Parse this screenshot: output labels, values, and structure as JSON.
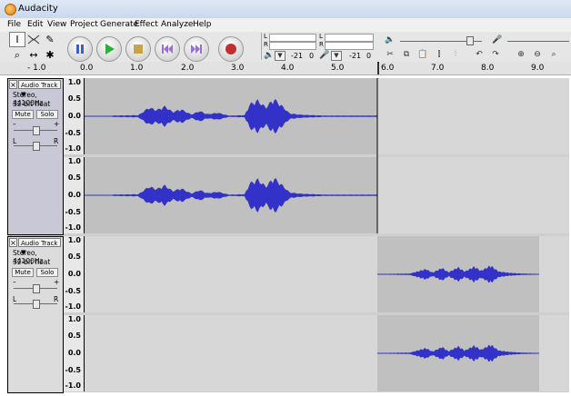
{
  "window": {
    "title": "Audacity"
  },
  "menu": [
    "File",
    "Edit",
    "View",
    "Project",
    "Generate",
    "Effect",
    "Analyze",
    "Help"
  ],
  "meters": {
    "output_label": "L",
    "output_label_r": "R",
    "input_label": "L",
    "input_label_r": "R",
    "output_db_value": "-21",
    "output_zero": "0",
    "input_db_value": "-21",
    "input_zero": "0"
  },
  "ruler": [
    "- 1.0",
    "0.0",
    "1.0",
    "2.0",
    "3.0",
    "4.0",
    "5.0",
    "6.0",
    "7.0",
    "8.0",
    "9.0"
  ],
  "tracks": [
    {
      "name": "Audio Track",
      "format": "Stereo, 44100Hz",
      "bits": "32-bit float",
      "mute_label": "Mute",
      "solo_label": "Solo",
      "gain_minus": "–",
      "gain_plus": "+",
      "pan_l": "L",
      "pan_r": "R",
      "scale": [
        "1.0",
        "0.5",
        "0.0",
        "-0.5",
        "-1.0"
      ]
    },
    {
      "name": "Audio Track",
      "format": "Stereo, 44100Hz",
      "bits": "32-bit float",
      "mute_label": "Mute",
      "solo_label": "Solo",
      "gain_minus": "–",
      "gain_plus": "+",
      "pan_l": "L",
      "pan_r": "R",
      "scale": [
        "1.0",
        "0.5",
        "0.0",
        "-0.5",
        "-1.0"
      ]
    }
  ],
  "colors": {
    "wave": "#3232c8",
    "clip_bg": "#c0c0c0",
    "track_bg": "#d7d7d7",
    "selected_panel": "#c8c8d6"
  }
}
